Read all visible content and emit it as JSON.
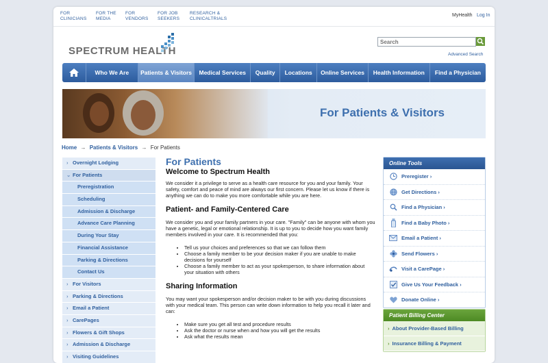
{
  "utility": {
    "links": [
      {
        "label": "FOR\nCLINICIANS"
      },
      {
        "label": "FOR THE\nMEDIA"
      },
      {
        "label": "FOR\nVENDORS"
      },
      {
        "label": "FOR JOB\nSEEKERS"
      },
      {
        "label": "RESEARCH &\nCLINICALTRIALS"
      }
    ],
    "myhealth": "MyHealth",
    "login": "Log In"
  },
  "logo": {
    "text": "SPECTRUM HEALTH"
  },
  "search": {
    "placeholder": "Search",
    "advanced": "Advanced Search"
  },
  "nav": {
    "items": [
      {
        "label": "Who We Are"
      },
      {
        "label": "Patients & Visitors"
      },
      {
        "label": "Medical Services"
      },
      {
        "label": "Quality"
      },
      {
        "label": "Locations"
      },
      {
        "label": "Online Services"
      },
      {
        "label": "Health Information"
      },
      {
        "label": "Find a Physician"
      }
    ],
    "active_index": 1
  },
  "banner": {
    "title": "For Patients & Visitors"
  },
  "breadcrumb": {
    "home": "Home",
    "section": "Patients & Visitors",
    "current": "For Patients",
    "separator": "→"
  },
  "leftnav": {
    "items": [
      {
        "label": "Overnight Lodging",
        "chev": "›"
      },
      {
        "label": "For Patients",
        "chev": "⌄"
      },
      {
        "label": "Preregistration"
      },
      {
        "label": "Scheduling"
      },
      {
        "label": "Admission & Discharge"
      },
      {
        "label": "Advance Care Planning"
      },
      {
        "label": "During Your Stay"
      },
      {
        "label": "Financial Assistance"
      },
      {
        "label": "Parking & Directions"
      },
      {
        "label": "Contact Us"
      },
      {
        "label": "For Visitors",
        "chev": "›"
      },
      {
        "label": "Parking & Directions",
        "chev": "›"
      },
      {
        "label": "Email a Patient",
        "chev": "›"
      },
      {
        "label": "CarePages",
        "chev": "›"
      },
      {
        "label": "Flowers & Gift Shops",
        "chev": "›"
      },
      {
        "label": "Admission & Discharge",
        "chev": "›"
      },
      {
        "label": "Visiting Guidelines",
        "chev": "›"
      }
    ]
  },
  "main": {
    "title": "For Patients",
    "welcome": "Welcome to Spectrum Health",
    "intro": "We consider it a privilege to serve as a health care resource for you and your family. Your safety, comfort and peace of mind are always our first concern. Please let us know if there is anything we can do to make you more comfortable while you are here.",
    "section1_title": "Patient- and Family-Centered Care",
    "section1_text": "We consider you and your family partners in your care. \"Family\" can be anyone with whom you have a genetic, legal or emotional relationship. It is up to you to decide how you want family members involved in your care. It is recommended that you:",
    "section1_bullets": [
      "Tell us your choices and preferences so that we can follow them",
      "Choose a family member to be your decision maker if you are unable to make decisions for yourself",
      "Choose a family member to act as your spokesperson, to share information about your situation with others"
    ],
    "section2_title": "Sharing Information",
    "section2_text": "You may want your spokesperson and/or decision maker to be with you during discussions with your medical team. This person can write down information to help you recall it later and can:",
    "section2_bullets": [
      "Make sure you get all test and procedure results",
      "Ask the doctor or nurse when and how you will get the results",
      "Ask what the results mean"
    ]
  },
  "tools": {
    "title": "Online Tools",
    "items": [
      {
        "label": "Preregister ›",
        "icon": "clock-icon"
      },
      {
        "label": "Get Directions ›",
        "icon": "globe-icon"
      },
      {
        "label": "Find a Physician ›",
        "icon": "magnifier-icon"
      },
      {
        "label": "Find a Baby Photo ›",
        "icon": "baby-bottle-icon"
      },
      {
        "label": "Email a Patient ›",
        "icon": "envelope-icon"
      },
      {
        "label": "Send Flowers ›",
        "icon": "flower-icon"
      },
      {
        "label": "Visit a CarePage ›",
        "icon": "carepage-icon"
      },
      {
        "label": "Give Us Your Feedback ›",
        "icon": "checkbox-icon"
      },
      {
        "label": "Donate Online ›",
        "icon": "heart-icon"
      }
    ]
  },
  "billing": {
    "title": "Patient Billing Center",
    "items": [
      {
        "label": "About Provider-Based Billing"
      },
      {
        "label": "Insurance Billing & Payment"
      }
    ]
  },
  "colors": {
    "accent": "#3d6fae",
    "nav": "#2d5c9e",
    "billing": "#5a9630"
  }
}
